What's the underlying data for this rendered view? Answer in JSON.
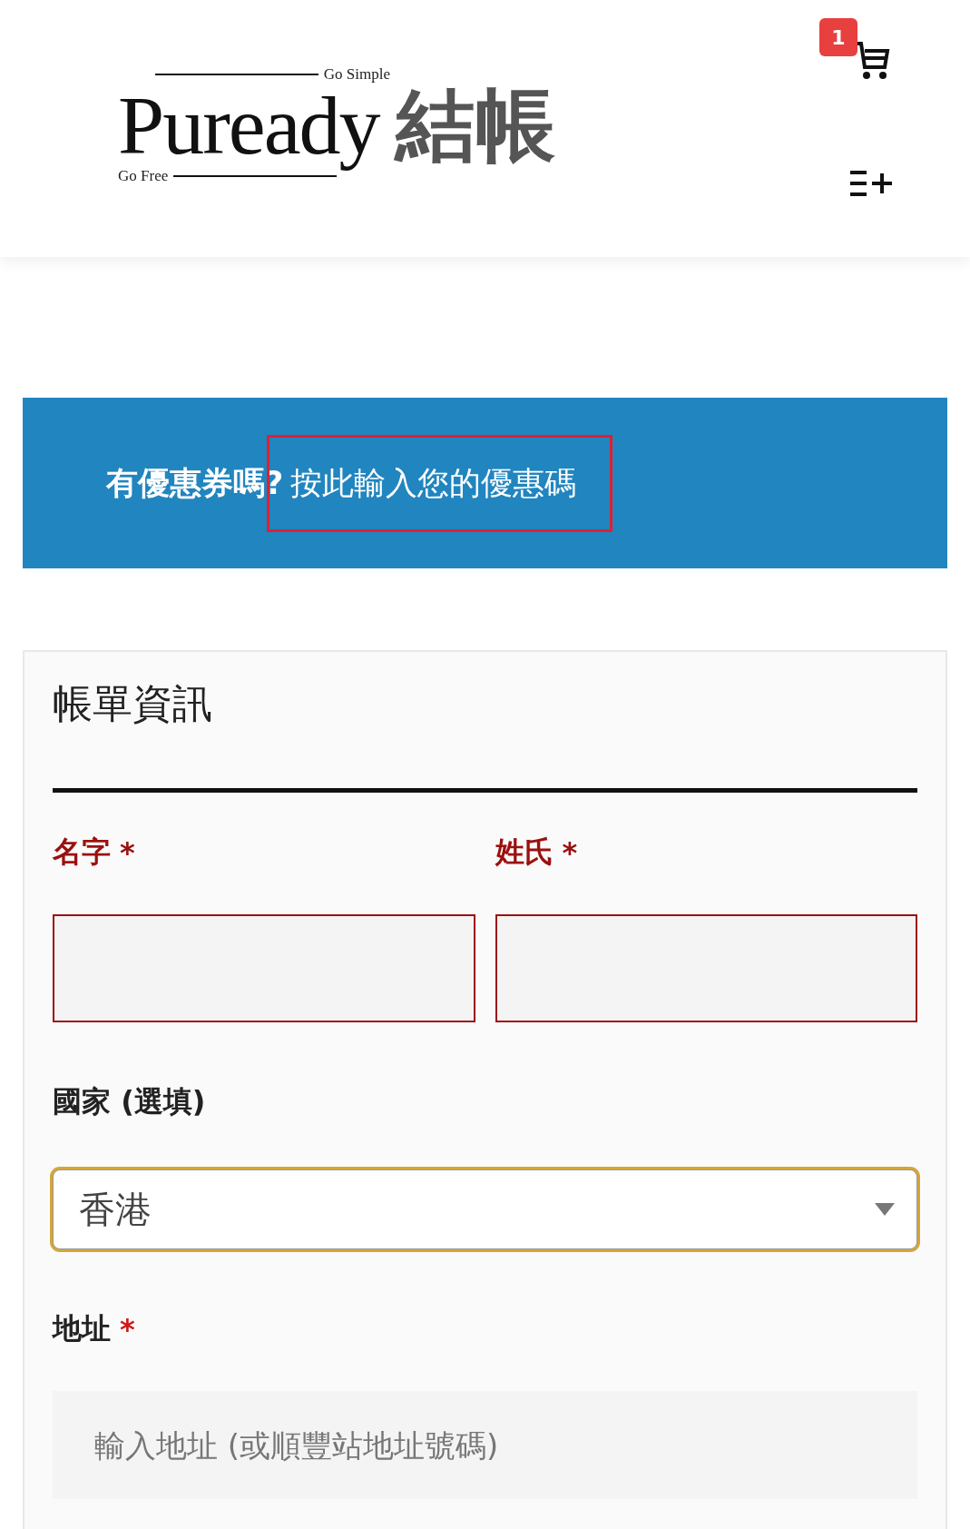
{
  "header": {
    "logo": {
      "tagline_top": "Go Simple",
      "wordmark": "Puready",
      "tagline_bottom": "Go Free"
    },
    "page_title": "結帳",
    "cart": {
      "badge": "1"
    }
  },
  "coupon": {
    "text": "有優惠券嗎?",
    "link": "按此輸入您的優惠碼",
    "highlighted": true
  },
  "billing": {
    "title": "帳單資訊",
    "rows": [
      [
        {
          "kind": "text",
          "label": "名字",
          "required_mark": "*",
          "invalid": true
        },
        {
          "kind": "text",
          "label": "姓氏",
          "required_mark": "*",
          "invalid": true
        }
      ],
      [
        {
          "kind": "select",
          "label": "國家 (選填)",
          "value": "香港",
          "focused": true,
          "invalid": false
        }
      ],
      [
        {
          "kind": "text",
          "label": "地址",
          "required_mark": "*",
          "placeholder": "輸入地址 (或順豐站地址號碼)",
          "invalid": false
        }
      ]
    ]
  }
}
